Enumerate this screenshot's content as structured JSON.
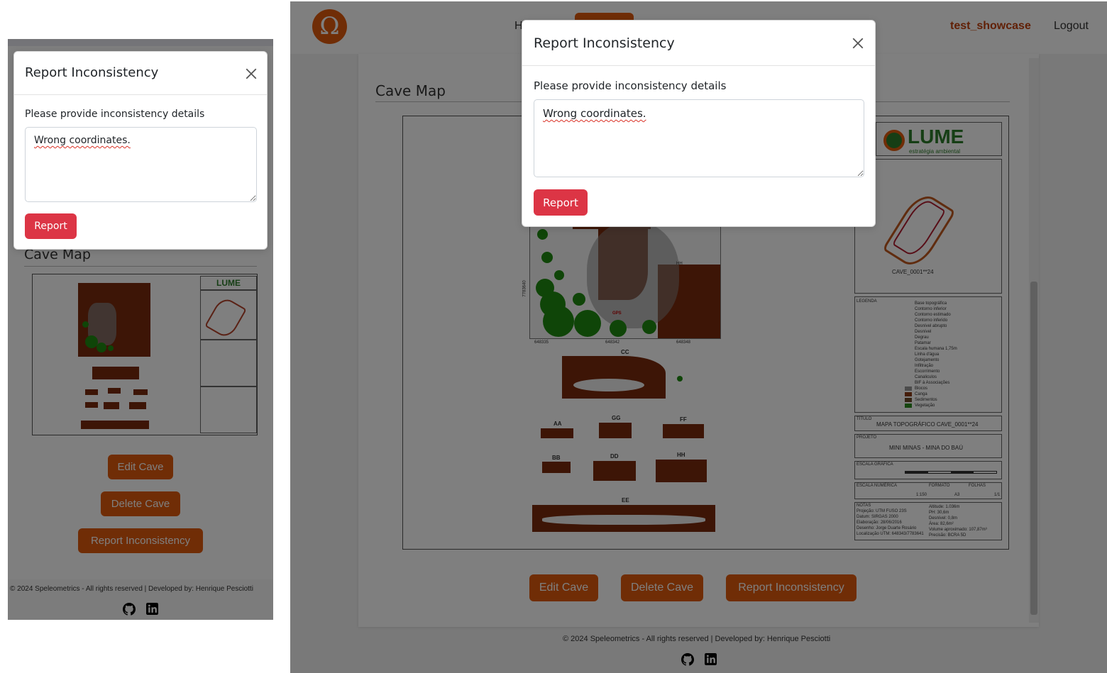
{
  "brand": {
    "logo_glyph": "Ω",
    "accent": "#e05a0c"
  },
  "nav": {
    "partial_link": "H",
    "user_name": "test_showcase",
    "logout_label": "Logout"
  },
  "section": {
    "cave_map_title": "Cave Map"
  },
  "actions": {
    "edit_label": "Edit Cave",
    "delete_label": "Delete Cave",
    "report_label": "Report Inconsistency"
  },
  "modal": {
    "title": "Report Inconsistency",
    "prompt": "Please provide inconsistency details",
    "text_value": "Wrong coordinates.",
    "submit_label": "Report"
  },
  "map": {
    "logo_text": "LUME",
    "logo_sub": "estratégia ambiental",
    "cave_label": "CAVE_0001**24",
    "legend_title": "LEGENDA",
    "titulo_label": "TÍTULO",
    "titulo_value": "MAPA TOPOGRÁFICO CAVE_0001**24",
    "projeto_label": "PROJETO",
    "projeto_value": "MINI MINAS - MINA DO BAÚ",
    "escala_grafica": "ESCALA GRÁFICA",
    "escala_numerica": "ESCALA NUMÉRICA",
    "escala_value": "1:150",
    "formato": "FORMATO",
    "formato_value": "A3",
    "folhas": "FOLHAS",
    "folhas_value": "1/1",
    "notas": "NOTAS",
    "notes_left": [
      "Projeção: UTM FUSO 23S",
      "Datum: SIRGAS 2000",
      "Elaboração: 28/06/2016",
      "Desenho: Jorge Duarte Rosário",
      "Localização UTM: 648343/7783641"
    ],
    "notes_right": [
      "Altitude: 1.036m",
      "PH: 30,6m",
      "Desnível: 0,8m",
      "Área: 82,6m²",
      "Volume aproximado: 107,87m³",
      "Precisão: BCRA 5D"
    ],
    "sections": [
      "CC",
      "AA",
      "GG",
      "FF",
      "BB",
      "DD",
      "HH",
      "EE"
    ],
    "hh_label": "HH",
    "gps_label": "GPS",
    "x_ticks": [
      "648335",
      "648342",
      "648348"
    ],
    "y_tick": "7783640",
    "legend_items": [
      "Base topográfica",
      "Contorno inferior",
      "Contorno estimado",
      "Contorno inferido",
      "Desnível abrupto",
      "Desnível",
      "Degrau",
      "Patamar",
      "Escala humana 1,75m",
      "Linha d'água",
      "Gotejamento",
      "Infiltração",
      "Escorrimento",
      "Canaliculos",
      "BIF à Associações",
      "Blocos",
      "Canga",
      "Sedimentos",
      "Vegetação"
    ]
  },
  "footer": {
    "copyright": "© 2024 Speleometrics - All rights reserved | Developed by: Henrique Pesciotti",
    "github_icon": "github-icon",
    "linkedin_icon": "linkedin-icon"
  }
}
